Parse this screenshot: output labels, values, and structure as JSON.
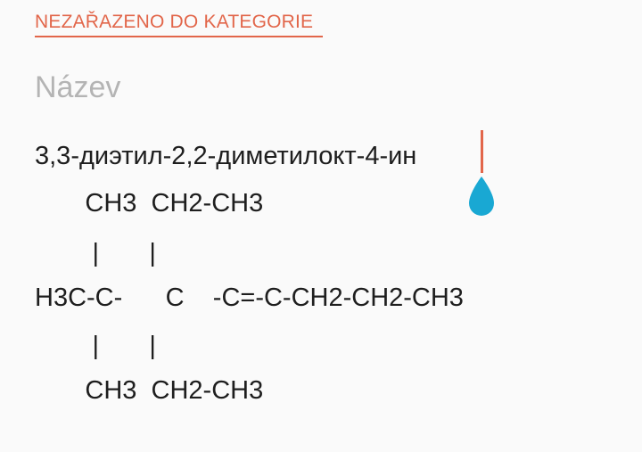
{
  "category": {
    "label": "NEZAŘAZENO DO KATEGORIE"
  },
  "title": {
    "placeholder": "Název"
  },
  "note": {
    "lines": [
      "3,3-диэтил-2,2-диметилокт-4-ин",
      "       CH3  CH2-CH3",
      "        |       |",
      "H3C-C-      C    -C=-C-CH2-CH2-CH3",
      "        |       |",
      "       CH3  CH2-CH3"
    ]
  },
  "colors": {
    "accent": "#e2664a",
    "handle": "#19a8d3",
    "placeholder": "#b4b4b4",
    "text": "#1e1e1e"
  },
  "icons": {
    "cursor_handle": "teardrop-handle-icon"
  }
}
